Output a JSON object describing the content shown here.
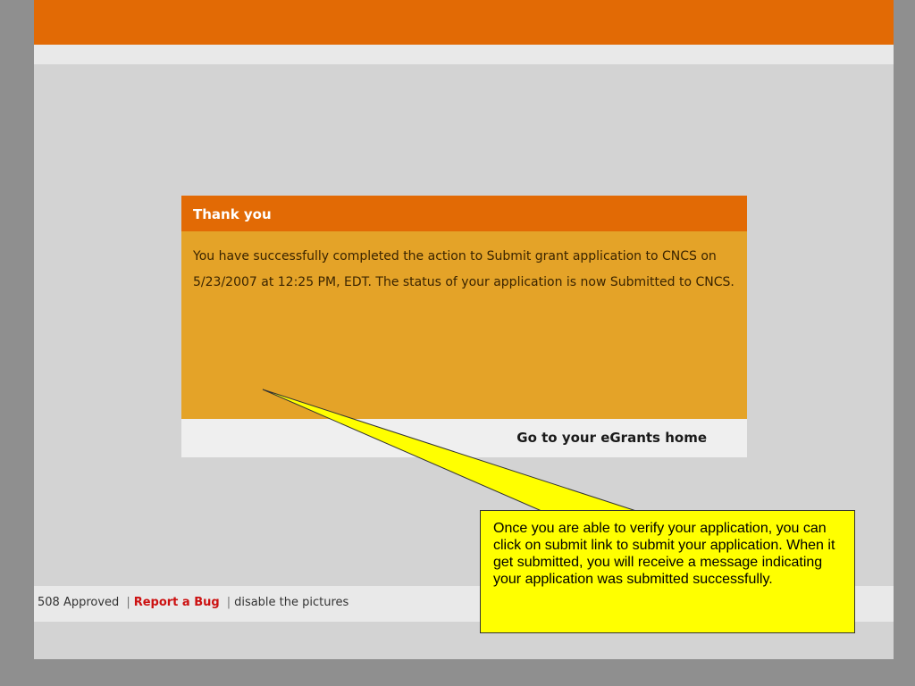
{
  "dialog": {
    "title": "Thank you",
    "message": "You have successfully completed the action to Submit grant application to CNCS on 5/23/2007 at 12:25 PM, EDT. The status of your application is now Submitted to CNCS.",
    "home_link": "Go to your eGrants home"
  },
  "footer": {
    "approved_label": "508 Approved",
    "separator": "|",
    "report_bug": "Report a Bug",
    "disable_pictures": "disable the pictures"
  },
  "callout": {
    "text": "Once you are able to verify your application, you can click on submit link to submit your application.  When it get submitted, you will receive a message indicating your application was submitted successfully."
  },
  "colors": {
    "orange": "#e26a05",
    "body_gold": "#e4a328",
    "callout_yellow": "#ffff00",
    "report_red": "#cc1111"
  }
}
